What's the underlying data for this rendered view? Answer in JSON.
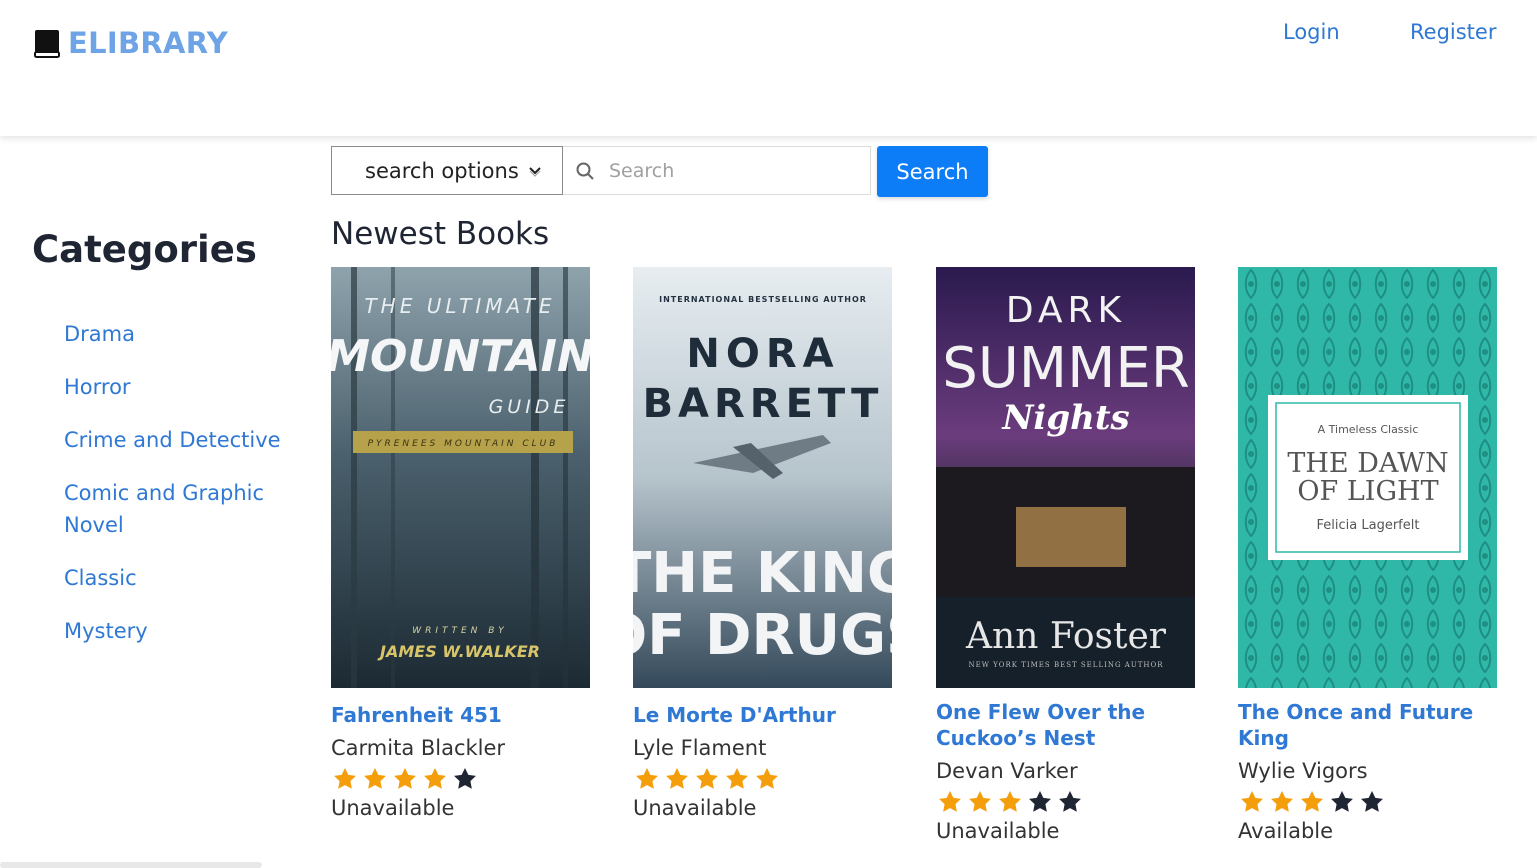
{
  "brand": {
    "name": "ELIBRARY",
    "icon": "book-icon",
    "color": "#6ea4e6"
  },
  "nav": {
    "login": "Login",
    "register": "Register"
  },
  "search": {
    "options_label": "search options",
    "placeholder": "Search",
    "button": "Search",
    "button_color": "#0d7df7"
  },
  "sidebar": {
    "title": "Categories",
    "items": [
      {
        "label": "Drama"
      },
      {
        "label": "Horror"
      },
      {
        "label": "Crime and Detective"
      },
      {
        "label": "Comic and Graphic Novel"
      },
      {
        "label": "Classic"
      },
      {
        "label": "Mystery"
      }
    ]
  },
  "main": {
    "section_title": "Newest Books",
    "books": [
      {
        "title": "Fahrenheit 451",
        "author": "Carmita Blackler",
        "rating": 4,
        "max_rating": 5,
        "availability": "Unavailable",
        "cover": {
          "line1": "THE ULTIMATE",
          "line2": "MOUNTAIN",
          "line3": "GUIDE",
          "band": "PYRENEES MOUNTAIN CLUB",
          "byline": "WRITTEN BY",
          "author": "JAMES W.WALKER"
        }
      },
      {
        "title": "Le Morte D'Arthur",
        "author": "Lyle Flament",
        "rating": 5,
        "max_rating": 5,
        "availability": "Unavailable",
        "cover": {
          "tagline": "INTERNATIONAL BESTSELLING AUTHOR",
          "author1": "NORA",
          "author2": "BARRETT",
          "title1": "THE KING",
          "title2": "OF DRUGS"
        }
      },
      {
        "title": "One Flew Over the Cuckoo’s Nest",
        "author": "Devan Varker",
        "rating": 3,
        "max_rating": 5,
        "availability": "Unavailable",
        "cover": {
          "line1": "DARK",
          "line2": "SUMMER",
          "line3": "Nights",
          "author": "Ann Foster",
          "tagline": "NEW YORK TIMES BEST SELLING AUTHOR"
        }
      },
      {
        "title": "The Once and Future King",
        "author": "Wylie Vigors",
        "rating": 3,
        "max_rating": 5,
        "availability": "Available",
        "cover": {
          "tagline": "A Timeless Classic",
          "title1": "THE DAWN",
          "title2": "OF LIGHT",
          "author": "Felicia Lagerfelt"
        }
      }
    ]
  },
  "colors": {
    "link": "#2f78d3",
    "star_filled": "#f59e0b",
    "star_empty": "#1f2533"
  }
}
